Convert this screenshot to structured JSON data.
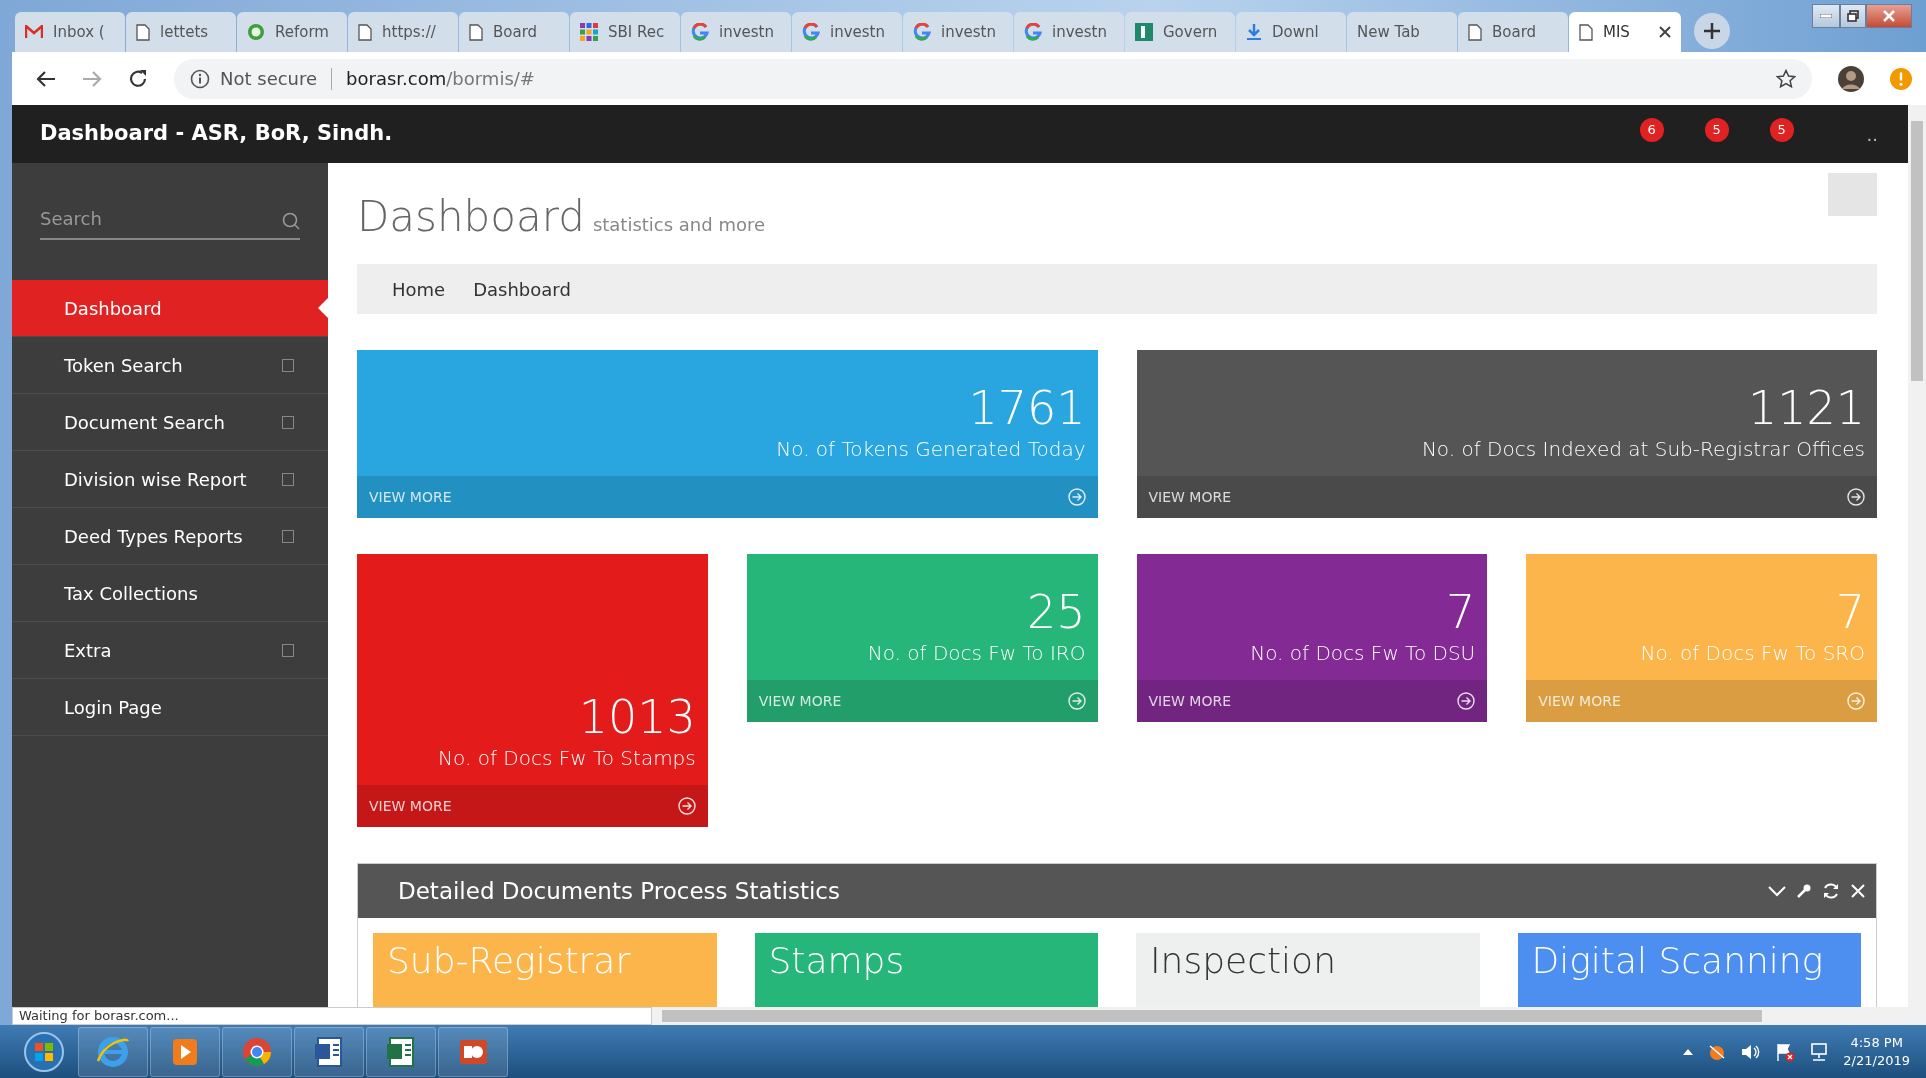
{
  "browser": {
    "tabs": [
      {
        "title": "Inbox (",
        "kind": "mail",
        "selected": false
      },
      {
        "title": "lettets",
        "kind": "page",
        "selected": false
      },
      {
        "title": "Reform",
        "kind": "ring",
        "selected": false
      },
      {
        "title": "https://",
        "kind": "page",
        "selected": false
      },
      {
        "title": "Board",
        "kind": "page",
        "selected": false
      },
      {
        "title": "SBI Rec",
        "kind": "grid",
        "selected": false
      },
      {
        "title": "investn",
        "kind": "g",
        "selected": false
      },
      {
        "title": "investn",
        "kind": "g",
        "selected": false
      },
      {
        "title": "investn",
        "kind": "g",
        "selected": false
      },
      {
        "title": "investn",
        "kind": "g",
        "selected": false
      },
      {
        "title": "Govern",
        "kind": "square",
        "selected": false
      },
      {
        "title": "Downl",
        "kind": "download",
        "selected": false
      },
      {
        "title": "New Tab",
        "kind": "plain",
        "selected": false
      },
      {
        "title": "Board",
        "kind": "page",
        "selected": false
      },
      {
        "title": "MIS",
        "kind": "page",
        "selected": true
      }
    ],
    "address": {
      "security": "Not secure",
      "host": "borasr.com",
      "path": "/bormis/#"
    }
  },
  "app": {
    "title": "Dashboard - ASR, BoR, Sindh.",
    "badges": [
      "6",
      "5",
      "5"
    ],
    "menu": ".."
  },
  "sidebar": {
    "search_placeholder": "Search",
    "items": [
      {
        "label": "Dashboard",
        "selected": true,
        "submenu": false
      },
      {
        "label": "Token Search",
        "selected": false,
        "submenu": true
      },
      {
        "label": "Document Search",
        "selected": false,
        "submenu": true
      },
      {
        "label": "Division wise Report",
        "selected": false,
        "submenu": true
      },
      {
        "label": "Deed Types Reports",
        "selected": false,
        "submenu": true
      },
      {
        "label": "Tax Collections",
        "selected": false,
        "submenu": false
      },
      {
        "label": "Extra",
        "selected": false,
        "submenu": true
      },
      {
        "label": "Login Page",
        "selected": false,
        "submenu": false
      }
    ]
  },
  "page": {
    "title": "Dashboard",
    "subtitle": "statistics and more",
    "breadcrumb": [
      "Home",
      "Dashboard"
    ]
  },
  "stats": [
    {
      "value": "1761",
      "label": "No. of Tokens Generated Today",
      "link": "VIEW MORE",
      "color": "#29a6df"
    },
    {
      "value": "1121",
      "label": "No. of Docs Indexed at Sub-Registrar Offices",
      "link": "VIEW MORE",
      "color": "#555555"
    },
    {
      "value": "1013",
      "label": "No. of Docs Fw To Stamps",
      "link": "VIEW MORE",
      "color": "#e31b1b"
    },
    {
      "value": "25",
      "label": "No. of Docs Fw To IRO",
      "link": "VIEW MORE",
      "color": "#26b67a"
    },
    {
      "value": "7",
      "label": "No. of Docs Fw To DSU",
      "link": "VIEW MORE",
      "color": "#832a95"
    },
    {
      "value": "7",
      "label": "No. of Docs Fw To SRO",
      "link": "VIEW MORE",
      "color": "#fcb54b"
    }
  ],
  "portlet": {
    "title": "Detailed Documents Process Statistics",
    "tiles": [
      {
        "title": "Sub-Registrar",
        "color": "#fcb54b"
      },
      {
        "title": "Stamps",
        "color": "#26b67a"
      },
      {
        "title": "Inspection",
        "color": "#eef0ef"
      },
      {
        "title": "Digital Scanning",
        "color": "#4d8ff0"
      }
    ]
  },
  "status": "Waiting for borasr.com...",
  "taskbar": {
    "time": "4:58 PM",
    "date": "2/21/2019"
  }
}
